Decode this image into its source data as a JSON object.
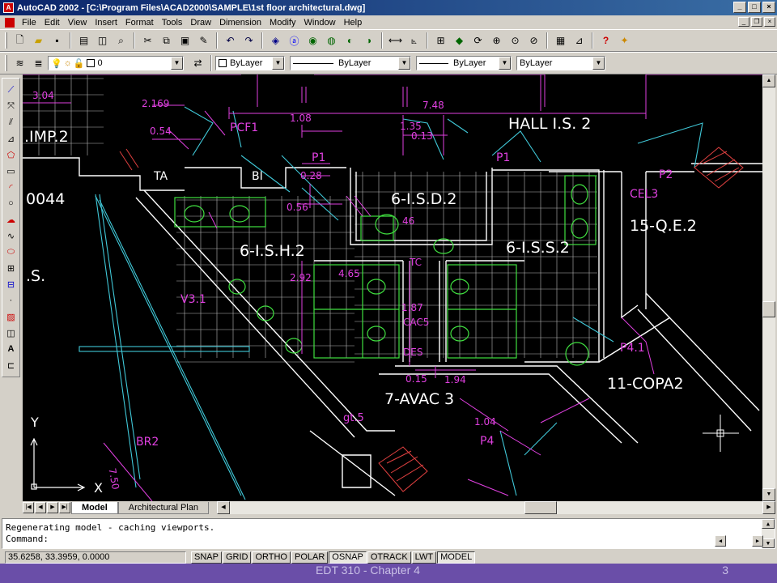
{
  "window": {
    "title": "AutoCAD 2002 - [C:\\Program Files\\ACAD2000\\SAMPLE\\1st floor architectural.dwg]"
  },
  "menu": [
    "File",
    "Edit",
    "View",
    "Insert",
    "Format",
    "Tools",
    "Draw",
    "Dimension",
    "Modify",
    "Window",
    "Help"
  ],
  "properties": {
    "layer_value": "0",
    "color_value": "ByLayer",
    "linetype_value": "ByLayer",
    "lineweight_value": "ByLayer",
    "plotstyle_value": "ByLayer"
  },
  "drawing": {
    "background": "#000000",
    "colors": {
      "magenta": "#e040e0",
      "white": "#ffffff",
      "green": "#40e040",
      "cyan": "#40c8d8",
      "red": "#e04040"
    },
    "labels": {
      "hall": "HALL I.S. 2",
      "imp": ".IMP.2",
      "pcf": "PCF1",
      "ta": "TA",
      "bi": "BI",
      "isd": "6-I.S.D.2",
      "ish": "6-I.S.H.2",
      "iss": "6-I.S.S.2",
      "qe": "15-Q.E.2",
      "copa": "11-COPA2",
      "avac": "7-AVAC 3",
      "room0044": "0044",
      "s": ".S.",
      "v31": "V3.1",
      "br2": "BR2",
      "cel3": "CEL3",
      "p1a": "P1",
      "p1b": "P1",
      "p2": "P2",
      "p41": "P4.1",
      "p4": "P4",
      "tc": "TC",
      "cac5": "CAC5",
      "des": "DES",
      "gt5": "gt.5"
    },
    "dimensions": {
      "d304": "3.04",
      "d2169": "2.169",
      "d748": "7.48",
      "d108": "1.08",
      "d135": "1.35",
      "d013": "0.13",
      "d054": "0.54",
      "d028": "0.28",
      "d056": "0.56",
      "d046": "46",
      "d292": "2.92",
      "d465": "4.65",
      "d187": "1.87",
      "d015": "0.15",
      "d194": "1.94",
      "d104": "1.04",
      "d750": "7.50"
    },
    "ucs": {
      "x": "X",
      "y": "Y"
    }
  },
  "tabs": [
    {
      "label": "Model",
      "active": true
    },
    {
      "label": "Architectural Plan",
      "active": false
    }
  ],
  "command": {
    "history": "Regenerating model - caching viewports.",
    "prompt": "Command:"
  },
  "status": {
    "coordinates": "35.6258, 33.3959, 0.0000",
    "buttons": [
      {
        "label": "SNAP",
        "on": false
      },
      {
        "label": "GRID",
        "on": false
      },
      {
        "label": "ORTHO",
        "on": false
      },
      {
        "label": "POLAR",
        "on": false
      },
      {
        "label": "OSNAP",
        "on": true
      },
      {
        "label": "OTRACK",
        "on": false
      },
      {
        "label": "LWT",
        "on": false
      },
      {
        "label": "MODEL",
        "on": true
      }
    ]
  },
  "footer": {
    "left": "EDT 310 - Chapter 4",
    "right": "3"
  }
}
